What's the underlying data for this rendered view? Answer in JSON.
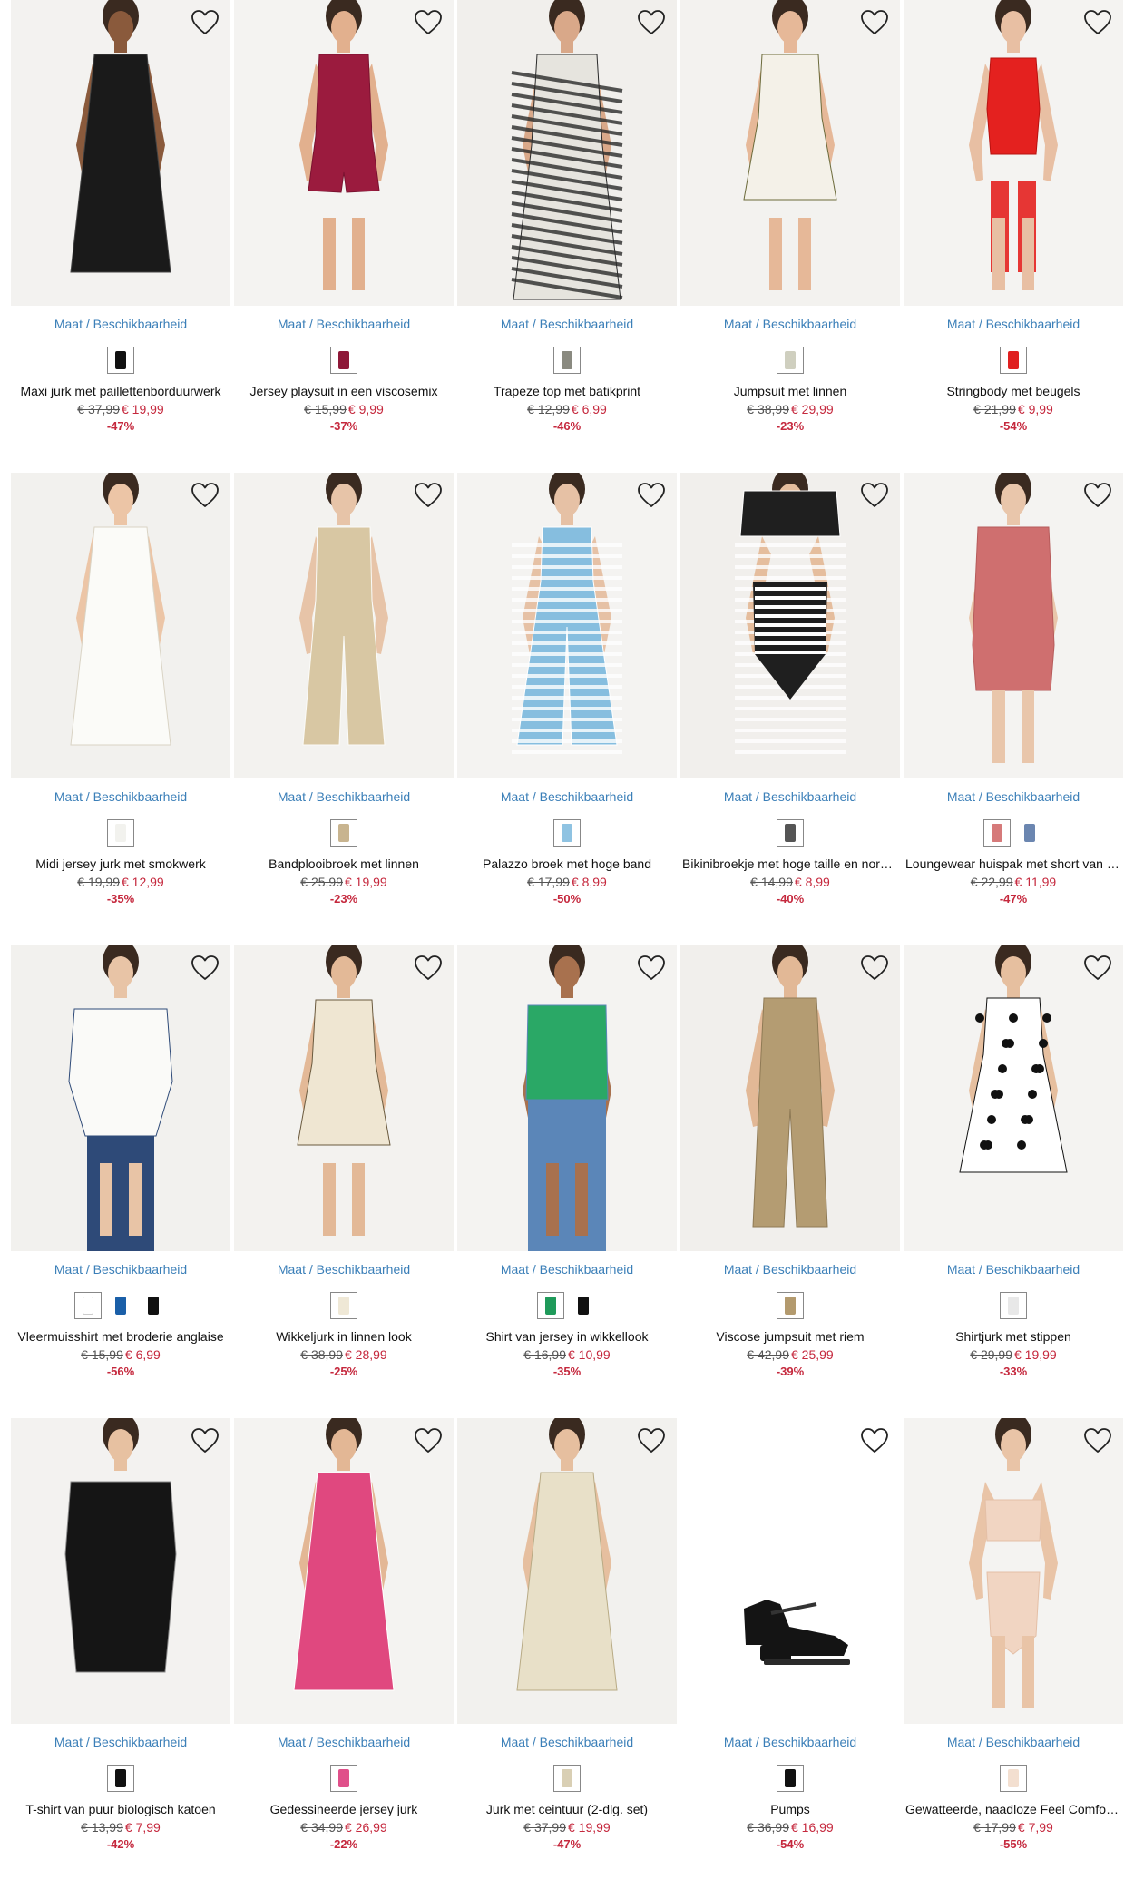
{
  "size_link_label": "Maat / Beschikbaarheid",
  "products": [
    {
      "name": "Maxi jurk met paillettenborduurwerk",
      "old_price": "€ 37,99",
      "new_price": "€ 19,99",
      "discount": "-47%",
      "swatches": [
        "#111111"
      ],
      "bg": "#f3f2f0",
      "garment": "#1a1a1a",
      "accent": "#444444",
      "shape": "dress-long",
      "skin": "#8a5a3c"
    },
    {
      "name": "Jersey playsuit in een viscosemix",
      "old_price": "€ 15,99",
      "new_price": "€ 9,99",
      "discount": "-37%",
      "swatches": [
        "#8e1838"
      ],
      "bg": "#f4f3f1",
      "garment": "#9b1b3e",
      "accent": "#7a1230",
      "shape": "playsuit",
      "skin": "#e2b08e"
    },
    {
      "name": "Trapeze top met batikprint",
      "old_price": "€ 12,99",
      "new_price": "€ 6,99",
      "discount": "-46%",
      "swatches": [
        "#8a8a80"
      ],
      "bg": "#f1efec",
      "garment": "#e6e4de",
      "accent": "#2a2a2a",
      "shape": "stripes",
      "skin": "#d9a889"
    },
    {
      "name": "Jumpsuit met linnen",
      "old_price": "€ 38,99",
      "new_price": "€ 29,99",
      "discount": "-23%",
      "swatches": [
        "#cfcfbf"
      ],
      "bg": "#f3f2ef",
      "garment": "#f4f1e8",
      "accent": "#6b6a3a",
      "shape": "dress-short",
      "skin": "#e6b898"
    },
    {
      "name": "Stringbody met beugels",
      "old_price": "€ 21,99",
      "new_price": "€ 9,99",
      "discount": "-54%",
      "swatches": [
        "#e02020"
      ],
      "bg": "#f4f3f1",
      "garment": "#e4211f",
      "accent": "#b8120f",
      "shape": "lingerie",
      "skin": "#e8bfa3"
    },
    {
      "name": "Midi jersey jurk met smokwerk",
      "old_price": "€ 19,99",
      "new_price": "€ 12,99",
      "discount": "-35%",
      "swatches": [
        "#f2f2ee"
      ],
      "bg": "#f2f1ee",
      "garment": "#fbfbf8",
      "accent": "#d9d3c4",
      "shape": "dress-long",
      "skin": "#ecc5a6"
    },
    {
      "name": "Bandplooibroek met linnen",
      "old_price": "€ 25,99",
      "new_price": "€ 19,99",
      "discount": "-23%",
      "swatches": [
        "#c8b48f"
      ],
      "bg": "#f3f2ef",
      "garment": "#d8c7a3",
      "accent": "#fbfbf8",
      "shape": "pants",
      "skin": "#e7c4a8"
    },
    {
      "name": "Palazzo broek met hoge band",
      "old_price": "€ 17,99",
      "new_price": "€ 8,99",
      "discount": "-50%",
      "swatches": [
        "#8fc3e2"
      ],
      "bg": "#f4f3f1",
      "garment": "#86bedf",
      "accent": "#ffffff",
      "shape": "pants-stripe",
      "skin": "#e6c1a5"
    },
    {
      "name": "Bikinibroekje met hoge taille en normale pasvorm",
      "old_price": "€ 14,99",
      "new_price": "€ 8,99",
      "discount": "-40%",
      "swatches": [
        "#555555"
      ],
      "bg": "#f1efec",
      "garment": "#1f1f1f",
      "accent": "#ffffff",
      "shape": "bikini",
      "skin": "#e5bd9d"
    },
    {
      "name": "Loungewear huispak met short van viscose",
      "old_price": "€ 22,99",
      "new_price": "€ 11,99",
      "discount": "-47%",
      "swatches": [
        "#d67a7a",
        "#6b86b0"
      ],
      "bg": "#f4f3f1",
      "garment": "#cf6f6f",
      "accent": "#b65b5b",
      "shape": "lounge",
      "skin": "#e9c6ab"
    },
    {
      "name": "Vleermuisshirt met broderie anglaise",
      "old_price": "€ 15,99",
      "new_price": "€ 6,99",
      "discount": "-56%",
      "swatches": [
        "#ffffff",
        "#1a5fa8",
        "#111111"
      ],
      "bg": "#f2f1ee",
      "garment": "#fafaf8",
      "accent": "#2e4a78",
      "shape": "shirt",
      "skin": "#e8c4a6"
    },
    {
      "name": "Wikkeljurk in linnen look",
      "old_price": "€ 38,99",
      "new_price": "€ 28,99",
      "discount": "-25%",
      "swatches": [
        "#efe8d6"
      ],
      "bg": "#f3f2ef",
      "garment": "#efe6d2",
      "accent": "#6a5a3e",
      "shape": "dress-short",
      "skin": "#e3b997"
    },
    {
      "name": "Shirt van jersey in wikkellook",
      "old_price": "€ 16,99",
      "new_price": "€ 10,99",
      "discount": "-35%",
      "swatches": [
        "#1f9a5a",
        "#111111"
      ],
      "bg": "#f4f3f1",
      "garment": "#2aa866",
      "accent": "#5b86b8",
      "shape": "shirt-jeans",
      "skin": "#a8714e"
    },
    {
      "name": "Viscose jumpsuit met riem",
      "old_price": "€ 42,99",
      "new_price": "€ 25,99",
      "discount": "-39%",
      "swatches": [
        "#b39a6e"
      ],
      "bg": "#f1efec",
      "garment": "#b49c72",
      "accent": "#8f7a55",
      "shape": "jumpsuit",
      "skin": "#e2b896"
    },
    {
      "name": "Shirtjurk met stippen",
      "old_price": "€ 29,99",
      "new_price": "€ 19,99",
      "discount": "-33%",
      "swatches": [
        "#e8e8e8"
      ],
      "bg": "#f4f3f1",
      "garment": "#ffffff",
      "accent": "#111111",
      "shape": "dots",
      "skin": "#e6bf9f"
    },
    {
      "name": "T-shirt van puur biologisch katoen",
      "old_price": "€ 13,99",
      "new_price": "€ 7,99",
      "discount": "-42%",
      "swatches": [
        "#111111"
      ],
      "bg": "#f3f2f0",
      "garment": "#151515",
      "accent": "#8a8a8a",
      "shape": "tshirt",
      "skin": "#e7c1a1"
    },
    {
      "name": "Gedessineerde jersey jurk",
      "old_price": "€ 34,99",
      "new_price": "€ 26,99",
      "discount": "-22%",
      "swatches": [
        "#e0508a"
      ],
      "bg": "#f4f3f1",
      "garment": "#e0487f",
      "accent": "#ffffff",
      "shape": "dress-long",
      "skin": "#e3b795"
    },
    {
      "name": "Jurk met ceintuur (2-dlg. set)",
      "old_price": "€ 37,99",
      "new_price": "€ 19,99",
      "discount": "-47%",
      "swatches": [
        "#d9cfb4"
      ],
      "bg": "#f2f1ee",
      "garment": "#e8e0c8",
      "accent": "#b8aa84",
      "shape": "dress-long",
      "skin": "#e6bf9f"
    },
    {
      "name": "Pumps",
      "old_price": "€ 36,99",
      "new_price": "€ 16,99",
      "discount": "-54%",
      "swatches": [
        "#111111"
      ],
      "bg": "#ffffff",
      "garment": "#141414",
      "accent": "#c9c9c9",
      "shape": "shoe",
      "skin": "#ffffff"
    },
    {
      "name": "Gewatteerde, naadloze Feel Comfort beha",
      "old_price": "€ 17,99",
      "new_price": "€ 7,99",
      "discount": "-55%",
      "swatches": [
        "#f3dfd0"
      ],
      "bg": "#f4f3f1",
      "garment": "#f1d5c2",
      "accent": "#e4bfa6",
      "shape": "bra",
      "skin": "#e9c4a7"
    }
  ]
}
